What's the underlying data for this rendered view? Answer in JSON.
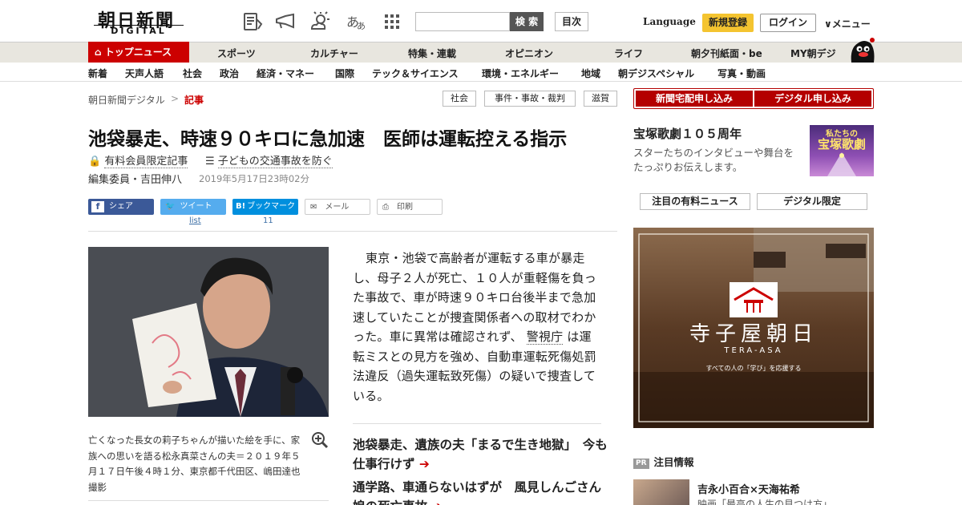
{
  "header": {
    "logo_top": "朝日新聞",
    "logo_bottom": "DIGITAL",
    "search_placeholder": "",
    "search_button": "検 索",
    "toc_button": "目次",
    "language": "Language",
    "register": "新規登録",
    "login": "ログイン",
    "menu": "メニュー",
    "icons": [
      "paper-icon",
      "megaphone-icon",
      "weather-icon",
      "font-size-icon",
      "grid-icon"
    ],
    "font_size_glyph": "あ",
    "font_size_glyph_small": "あ"
  },
  "nav_main": {
    "top": "トップニュース",
    "items": [
      "スポーツ",
      "カルチャー",
      "特集・連載",
      "オピニオン",
      "ライフ",
      "朝夕刊紙面・be",
      "MY朝デジ"
    ]
  },
  "nav_sub": {
    "items": [
      "新着",
      "天声人語",
      "社会",
      "政治",
      "経済・マネー",
      "国際",
      "テック＆サイエンス",
      "環境・エネルギー",
      "地域",
      "朝デジスペシャル",
      "写真・動画"
    ]
  },
  "breadcrumb": {
    "home": "朝日新聞デジタル",
    "sep": ">",
    "current": "記事"
  },
  "tags": [
    "社会",
    "事件・事故・裁判",
    "滋賀"
  ],
  "article": {
    "headline": "池袋暴走、時速９０キロに急加速　医師は運転控える指示",
    "members_only": "有料会員限定記事",
    "series": "子どもの交通事故を防ぐ",
    "author": "編集委員・吉田伸八",
    "date": "2019年5月17日23時02分",
    "share": {
      "facebook": "シェア",
      "twitter": "ツイート",
      "twitter_count": "list",
      "hatena": "ブックマーク",
      "hatena_count": "11",
      "mail": "メール",
      "print": "印刷"
    },
    "caption": "亡くなった長女の莉子ちゃんが描いた絵を手に、家族への思いを語る松永真菜さんの夫＝２０１９年５月１７日午後４時１分、東京都千代田区、嶋田達也撮影",
    "body_before_link": "東京・池袋で高齢者が運転する車が暴走し、母子２人が死亡、１０人が重軽傷を負った事故で、車が時速９０キロ台後半まで急加速していたことが捜査関係者への取材でわかった。車に異常は確認されず、",
    "body_link": "警視庁",
    "body_after_link": "は運転ミスとの見方を強め、自動車運転死傷処罰法違反（過失運転致死傷）の疑いで捜査している。",
    "related": [
      "池袋暴走、遺族の夫「まるで生き地獄」　今も仕事行けず",
      "通学路、車通らないはずが　風見しんごさん娘の死亡事故"
    ]
  },
  "sidebar": {
    "btn_delivery": "新聞宅配申し込み",
    "btn_digital": "デジタル申し込み",
    "tz_title": "宝塚歌劇１０５周年",
    "tz_desc": "スターたちのインタビューや舞台をたっぷりお伝えします。",
    "tz_img_text1": "私たちの",
    "tz_img_text2": "宝塚歌劇",
    "tab_paid": "注目の有料ニュース",
    "tab_digital": "デジタル限定",
    "ad_title": "寺子屋朝日",
    "ad_sub": "TERA-ASA",
    "ad_tag": "すべての人の「学び」を応援する",
    "pr_badge": "PR",
    "pr_label": "注目情報",
    "pr_title": "吉永小百合×天海祐希",
    "pr_sub": "映画「最高の人生の見つけ方」"
  },
  "colors": {
    "brand_red": "#c00000",
    "register_yellow": "#f4c430",
    "facebook": "#3b5998",
    "twitter": "#55acee",
    "hatena": "#008fde"
  }
}
